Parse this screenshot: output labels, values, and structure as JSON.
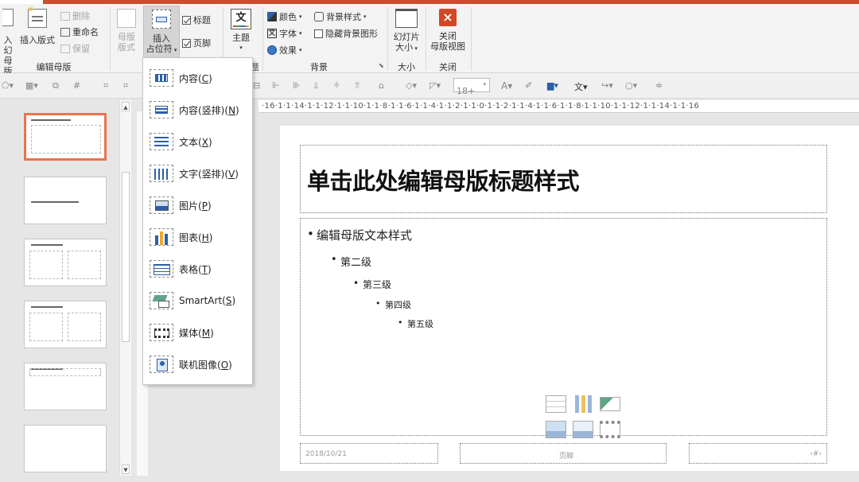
{
  "ribbon": {
    "insert_slide_master_l1": "入幻",
    "insert_slide_master_l2": "母版",
    "insert_layout": "插入版式",
    "delete": "删除",
    "rename": "重命名",
    "preserve": "保留",
    "master_layout_l1": "母版",
    "master_layout_l2": "版式",
    "insert_placeholder_l1": "插入",
    "insert_placeholder_l2": "占位符",
    "title_checkbox": "标题",
    "footer_checkbox": "页脚",
    "theme": "主题",
    "colors": "颜色",
    "fonts": "字体",
    "effects": "效果",
    "background_styles": "背景样式",
    "hide_background_graphics": "隐藏背景图形",
    "slide_size_l1": "幻灯片",
    "slide_size_l2": "大小",
    "close_l1": "关闭",
    "close_l2": "母版视图",
    "group_edit_master": "编辑母版",
    "group_theme_tail": "题",
    "group_background": "背景",
    "group_size": "大小",
    "group_close": "关闭"
  },
  "qbar": {
    "font_size": "18+"
  },
  "ruler": {
    "marks": "·16·1·1·14·1·1·12·1·1·10·1·1·8·1·1·6·1·1·4·1·1·2·1·1·0·1·1·2·1·1·4·1·1·6·1·1·8·1·1·10·1·1·12·1·1·14·1·1·16"
  },
  "menu": {
    "items": [
      {
        "label": "内容",
        "key": "C"
      },
      {
        "label": "内容(竖排)",
        "key": "N"
      },
      {
        "label": "文本",
        "key": "X"
      },
      {
        "label": "文字(竖排)",
        "key": "V"
      },
      {
        "label": "图片",
        "key": "P"
      },
      {
        "label": "图表",
        "key": "H"
      },
      {
        "label": "表格",
        "key": "T"
      },
      {
        "label": "SmartArt",
        "key": "S"
      },
      {
        "label": "媒体",
        "key": "M"
      },
      {
        "label": "联机图像",
        "key": "O"
      }
    ]
  },
  "slide": {
    "title": "单击此处编辑母版标题样式",
    "level1": "编辑母版文本样式",
    "level2": "第二级",
    "level3": "第三级",
    "level4": "第四级",
    "level5": "第五级",
    "footer_date": "2018/10/21",
    "footer_center": "页脚",
    "footer_right": "‹#›"
  },
  "colors": {
    "accent": "#c84e2f",
    "selection": "#e8754f"
  }
}
